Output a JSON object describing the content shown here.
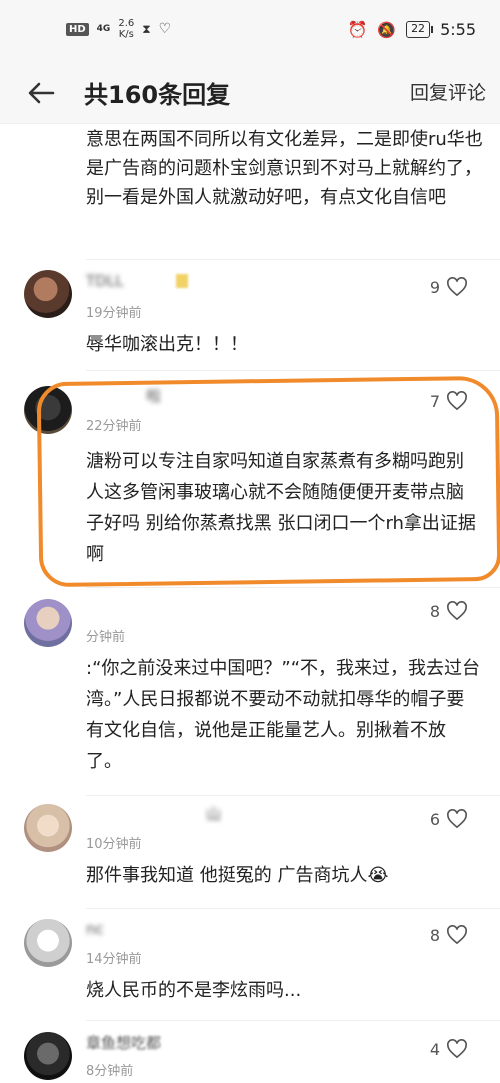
{
  "status_bar": {
    "hd": "HD",
    "network": "4G",
    "speed": "2.6\nK/s",
    "battery": "22",
    "time": "5:55"
  },
  "header": {
    "title": "共160条回复",
    "action": "回复评论"
  },
  "previous_text": "意思在两国不同所以有文化差异，二是即使ru华也是广告商的问题朴宝剑意识到不对马上就解约了，别一看是外国人就激动好吧，有点文化自信吧",
  "comments": [
    {
      "username": "TDLL　",
      "time": "19分钟前",
      "likes": "9",
      "content": "辱华咖滚出克！！！"
    },
    {
      "username": "　　　　啦",
      "time": "22分钟前",
      "likes": "7",
      "content": "溏粉可以专注自家吗知道自家蒸煮有多糊吗跑别人这多管闲事玻璃心就不会随随便便开麦带点脑子好吗 别给你蒸煮找黑 张口闭口一个rh拿出证据啊"
    },
    {
      "username": "　　　　　　　　",
      "time": "分钟前",
      "likes": "8",
      "content": ":“你之前没来过中国吧？”“不，我来过，我去过台湾。”人民日报都说不要动不动就扣辱华的帽子要有文化自信，说他是正能量艺人。别揪着不放了。"
    },
    {
      "username": "　　　　　　　　山",
      "time": "10分钟前",
      "likes": "6",
      "content": "那件事我知道 他挺冤的 广告商坑人😭"
    },
    {
      "username": "nc　　　　",
      "time": "14分钟前",
      "likes": "8",
      "content": "烧人民币的不是李炫雨吗..."
    },
    {
      "username": "章鱼想吃都",
      "time": "8分钟前",
      "likes": "4",
      "content": ""
    }
  ]
}
